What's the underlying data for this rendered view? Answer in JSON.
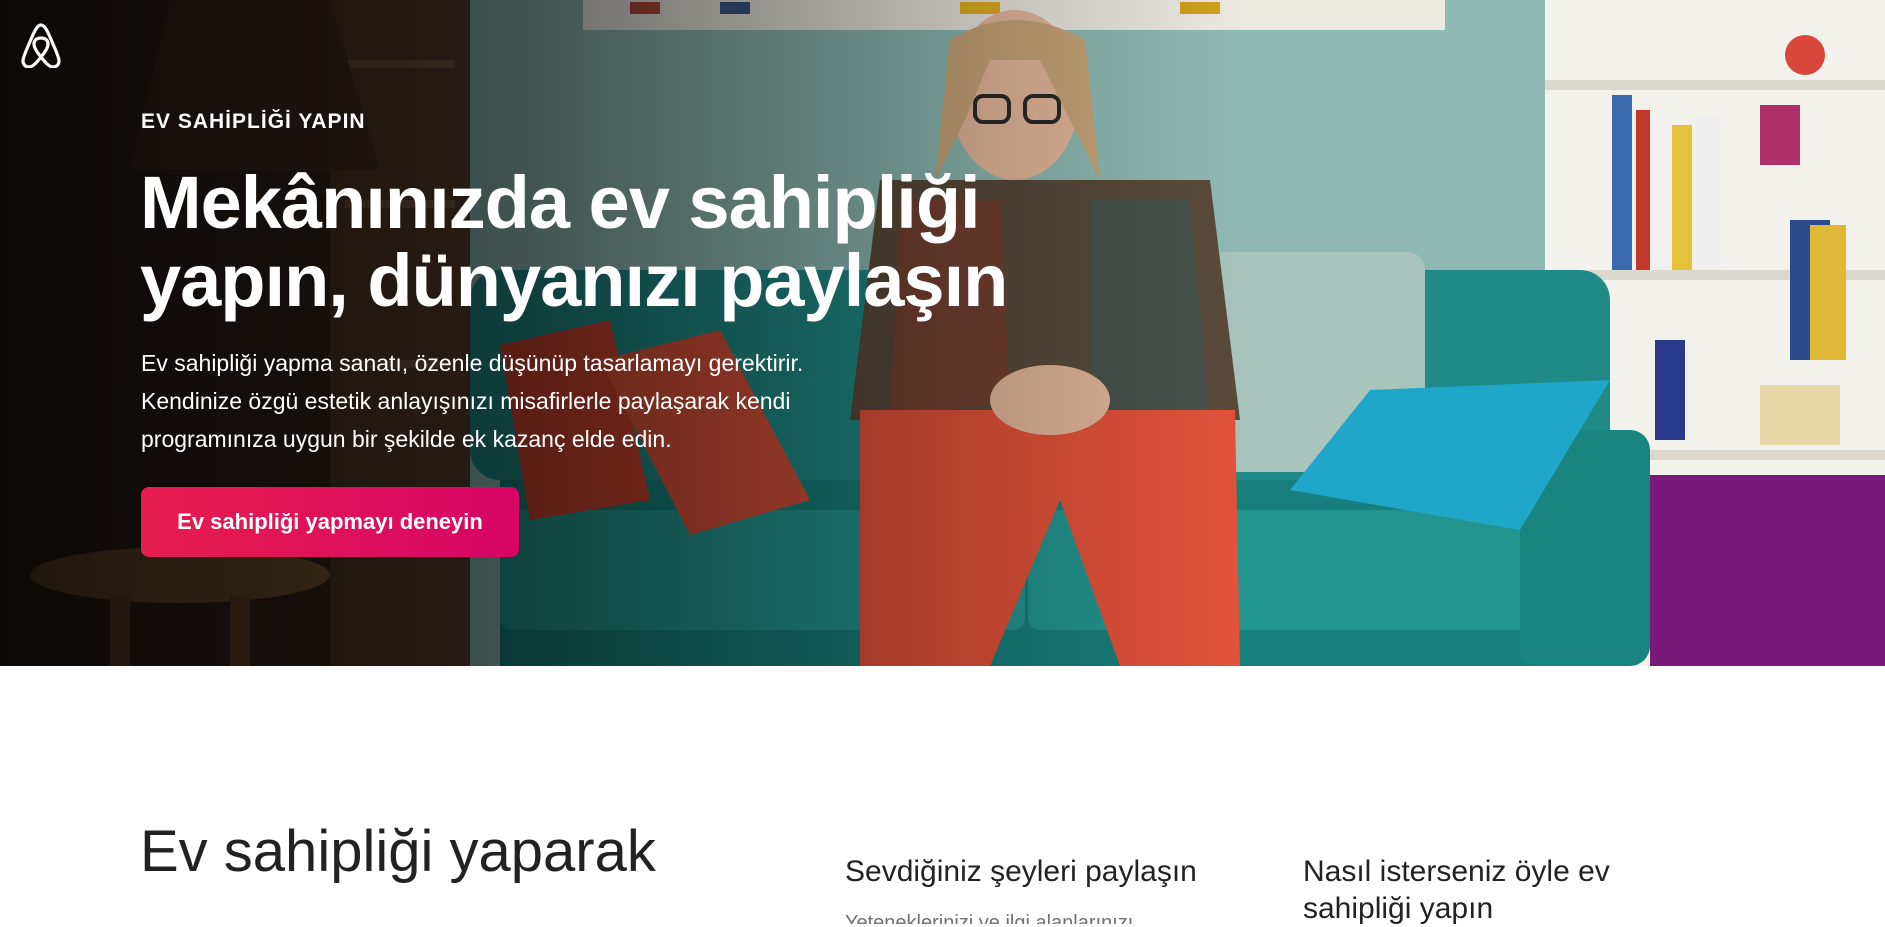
{
  "hero": {
    "eyebrow": "EV SAHİPLİĞİ YAPIN",
    "title": "Mekânınızda ev sahipliği yapın, dünyanızı paylaşın",
    "description_lines": [
      "Ev sahipliği yapma sanatı, özenle düşünüp tasarlamayı gerektirir.",
      "Kendinize özgü estetik anlayışınızı misafirlerle paylaşarak kendi",
      "programınıza uygun bir şekilde ek kazanç elde edin."
    ],
    "cta_label": "Ev sahipliği yapmayı deneyin"
  },
  "icons": {
    "logo": "airbnb-logo-icon"
  },
  "colors": {
    "accent_start": "#e61e4d",
    "accent_end": "#d70466",
    "text": "#222222"
  },
  "content": {
    "section_heading": "Ev sahipliği yaparak",
    "features": [
      {
        "title": "Sevdiğiniz şeyleri paylaşın",
        "body": "Yeteneklerinizi ve ilgi alanlarınızı"
      },
      {
        "title": "Nasıl isterseniz öyle ev sahipliği yapın"
      }
    ]
  }
}
